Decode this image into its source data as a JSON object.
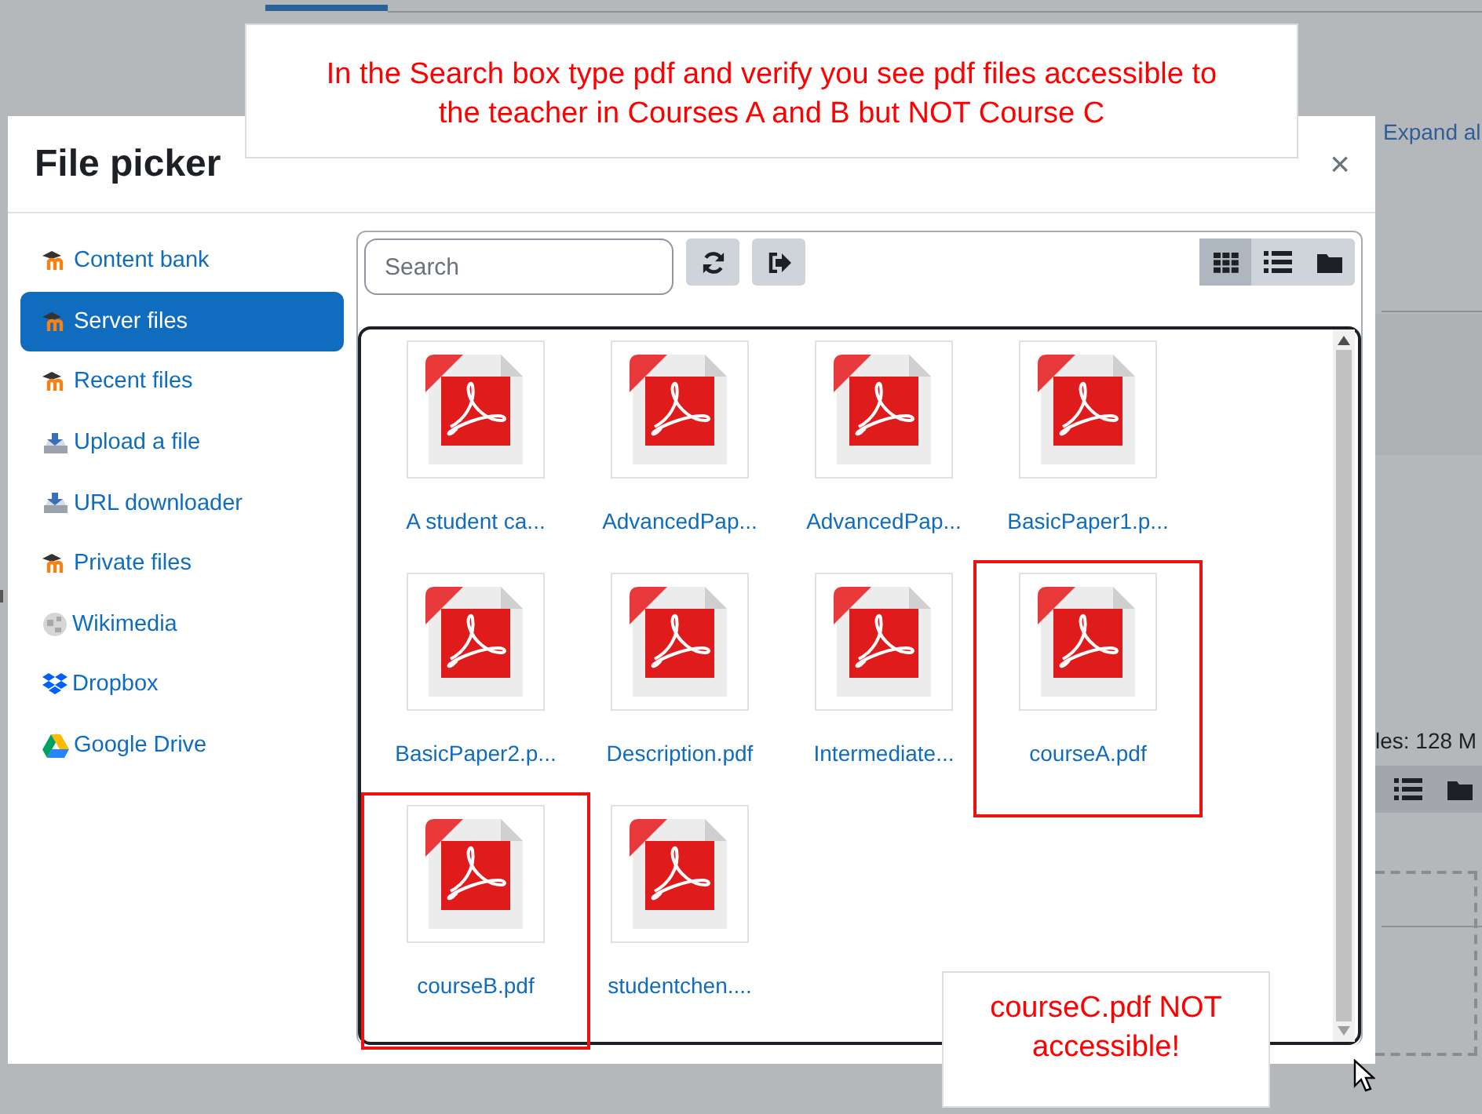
{
  "background_page": {
    "expand_link": "Expand al",
    "size_text": "les: 128 M"
  },
  "dialog": {
    "title": "File picker",
    "close": "×"
  },
  "sidebar": {
    "items": [
      {
        "label": "Content bank",
        "kind": "moodle",
        "selected": false
      },
      {
        "label": "Server files",
        "kind": "moodle",
        "selected": true
      },
      {
        "label": "Recent files",
        "kind": "moodle",
        "selected": false
      },
      {
        "label": "Upload a file",
        "kind": "upload",
        "selected": false
      },
      {
        "label": "URL downloader",
        "kind": "upload",
        "selected": false
      },
      {
        "label": "Private files",
        "kind": "moodle",
        "selected": false
      },
      {
        "label": "Wikimedia",
        "kind": "wiki",
        "selected": false
      },
      {
        "label": "Dropbox",
        "kind": "dropbox",
        "selected": false
      },
      {
        "label": "Google Drive",
        "kind": "gdrive",
        "selected": false
      }
    ]
  },
  "toolbar": {
    "search": {
      "placeholder": "Search"
    },
    "view_modes": [
      {
        "kind": "grid",
        "selected": true
      },
      {
        "kind": "list",
        "selected": false
      },
      {
        "kind": "tree",
        "selected": false
      }
    ]
  },
  "files": [
    {
      "name": "A student ca...",
      "annotated": false
    },
    {
      "name": "AdvancedPap...",
      "annotated": false
    },
    {
      "name": "AdvancedPap...",
      "annotated": false
    },
    {
      "name": "BasicPaper1.p...",
      "annotated": false
    },
    {
      "name": "BasicPaper2.p...",
      "annotated": false
    },
    {
      "name": "Description.pdf",
      "annotated": false
    },
    {
      "name": "Intermediate...",
      "annotated": false
    },
    {
      "name": "courseA.pdf",
      "annotated": true
    },
    {
      "name": "courseB.pdf",
      "annotated": true
    },
    {
      "name": "studentchen....",
      "annotated": false
    }
  ],
  "annotations": {
    "top_note": "In the Search box type pdf and verify you see pdf files accessible to the teacher in Courses A and B but NOT Course C",
    "bottom_note": "courseC.pdf NOT accessible!"
  }
}
